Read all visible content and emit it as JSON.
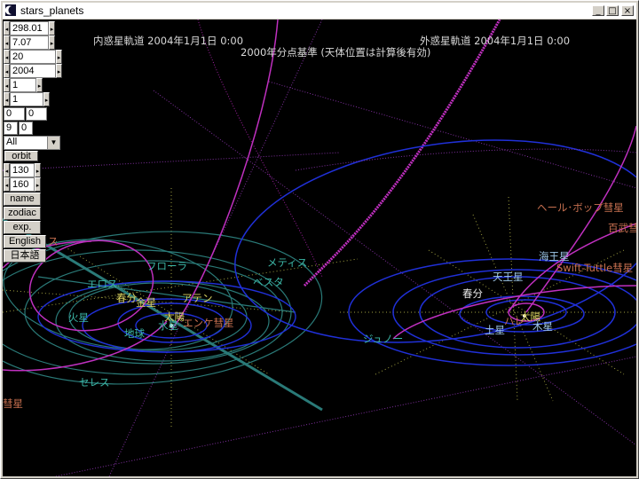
{
  "window": {
    "title": "stars_planets",
    "min_glyph": "_",
    "max_glyph": "□",
    "close_glyph": "×"
  },
  "header": {
    "inner": "内惑星軌道  2004年1月1日  0:00",
    "outer": "外惑星軌道  2004年1月1日  0:00",
    "epoch": "2000年分点基準 (天体位置は計算後有効)"
  },
  "controls": {
    "spin1": "298.01",
    "spin2": "7.07",
    "spin3": "20",
    "spin4": "2004",
    "spin5": "1",
    "spin6": "1",
    "box_a1": "0",
    "box_a2": "0",
    "box_b1": "9",
    "box_b2": "0",
    "select_value": "All",
    "orbit_button": "orbit",
    "spin7": "130",
    "spin8": "160",
    "name_button": "name",
    "zodiac_button": "zodiac",
    "exp_button": "exp.",
    "english_button": "English",
    "japanese_button": "日本語"
  },
  "labels": {
    "flora": "フローラ",
    "metis": "メティス",
    "eros": "エロス",
    "vesta": "ベスタ",
    "vernal_left": "春分",
    "venus": "金星",
    "aten": "アテン",
    "mars": "火星",
    "sun_left": "太陽",
    "encke": "エンケ彗星",
    "earth": "地球",
    "mercury": "水星",
    "ceres": "セレス",
    "comet_edge": "彗星",
    "juno": "ジュノー",
    "hale_bopp": "ヘール･ボップ彗星",
    "hyakutake": "百武彗",
    "neptune": "海王星",
    "swift_tuttle": "Swift-Tuttle彗星",
    "uranus": "天王星",
    "vernal_right": "春分",
    "sun_right": "太陽",
    "saturn": "土星",
    "jupiter": "木星",
    "halley": "ハレ",
    "left_edge": "ス"
  },
  "colors": {
    "background": "#000000",
    "title_text": "#d8d8d8",
    "inner_label": "#3cb8a8",
    "planet_label": "#9ec7e8",
    "comet_label": "#c87050",
    "yellow_label": "#d8d060",
    "orbit_blue": "#2030d8",
    "orbit_teal": "#2a7a78",
    "orbit_magenta": "#c030c0",
    "axis_dots": "#c8c850"
  }
}
